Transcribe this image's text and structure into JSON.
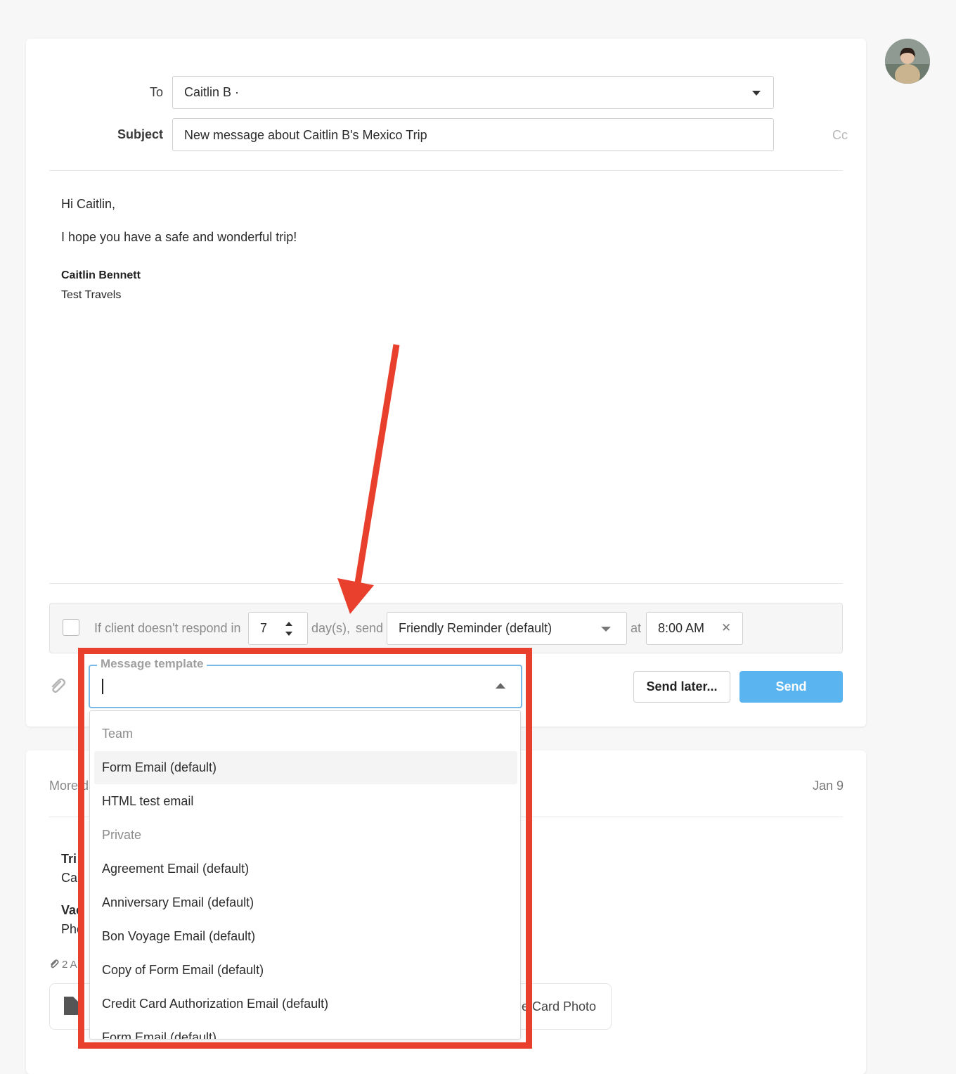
{
  "compose": {
    "to_label": "To",
    "to_value": "Caitlin B ·",
    "subject_label": "Subject",
    "subject_value": "New message about Caitlin B's Mexico Trip",
    "cc_label": "Cc",
    "body": {
      "greeting": "Hi Caitlin,",
      "line1": "I hope you have a safe and wonderful trip!",
      "signature_name": "Caitlin Bennett",
      "signature_company": "Test Travels"
    }
  },
  "followup": {
    "prefix": "If client doesn't respond in",
    "days_value": "7",
    "days_suffix": "day(s),",
    "send_label": "send",
    "reminder_value": "Friendly Reminder (default)",
    "at_label": "at",
    "time_value": "8:00 AM",
    "clear_symbol": "✕"
  },
  "actions": {
    "send_later": "Send later...",
    "send": "Send"
  },
  "template_picker": {
    "legend": "Message template",
    "value": "",
    "groups": [
      {
        "label": "Team",
        "items": [
          "Form Email (default)",
          "HTML test email"
        ]
      },
      {
        "label": "Private",
        "items": [
          "Agreement Email (default)",
          "Anniversary Email (default)",
          "Bon Voyage Email (default)",
          "Copy of Form Email (default)",
          "Credit Card Authorization Email (default)",
          "Form Email (default)"
        ]
      }
    ]
  },
  "history": {
    "header_left": "More d",
    "date": "Jan 9",
    "line1a": "Tri",
    "line1b": "Ca",
    "line2a": "Vac",
    "line2b": "Pho",
    "attachments_label": "2 A",
    "attachment_card_text": "e Card Photo"
  },
  "colors": {
    "accent_blue": "#59b4ef",
    "highlight_red": "#e8402d"
  },
  "icons": {
    "attach": "paperclip-icon",
    "avatar": "user-avatar"
  }
}
